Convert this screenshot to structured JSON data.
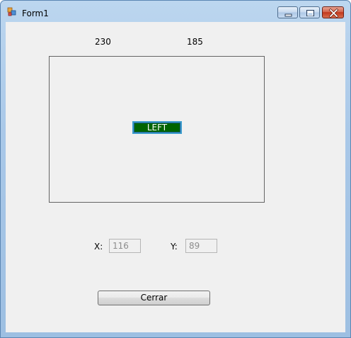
{
  "window": {
    "title": "Form1",
    "icons": {
      "app": "winforms-app-icon",
      "minimize": "minimize-icon",
      "maximize": "maximize-icon",
      "close": "close-icon"
    }
  },
  "coords": {
    "top_left_value": "230",
    "top_right_value": "185"
  },
  "panel": {
    "button_label": "LEFT",
    "button_color": "#006400"
  },
  "fields": {
    "x_label": "X:",
    "x_value": "116",
    "y_label": "Y:",
    "y_value": "89"
  },
  "actions": {
    "close_label": "Cerrar"
  }
}
